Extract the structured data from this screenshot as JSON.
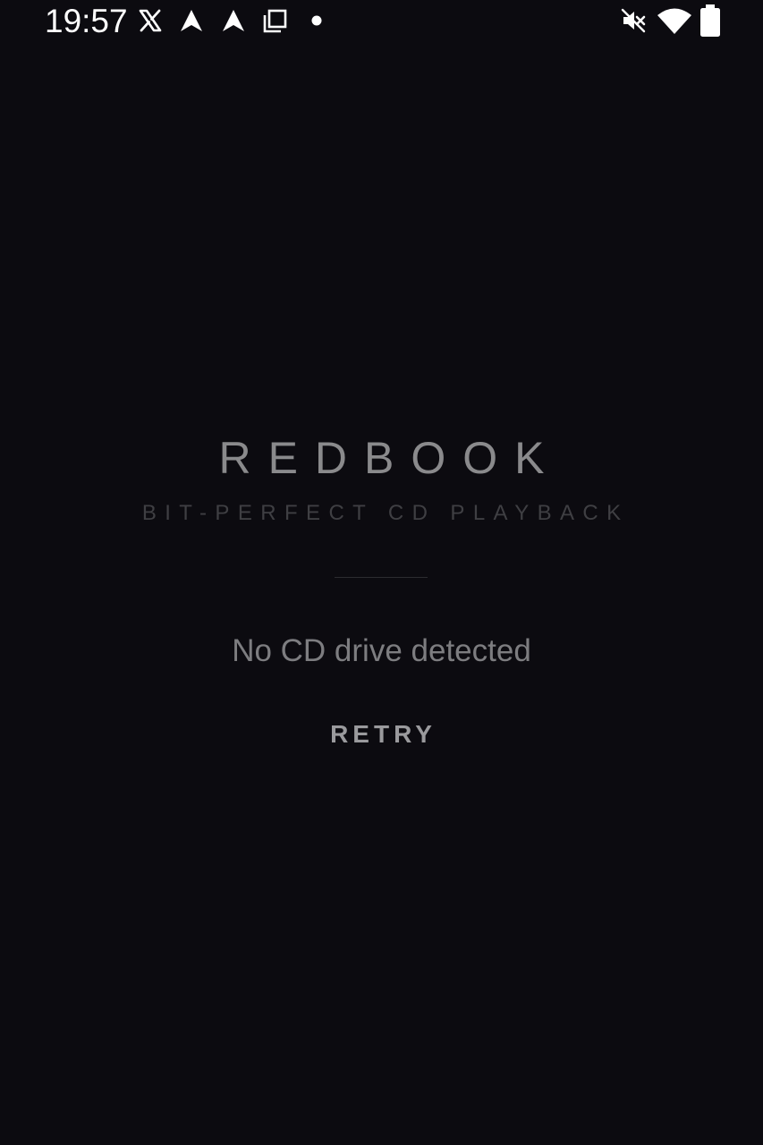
{
  "status_bar": {
    "time": "19:57",
    "notification_icons": [
      "x-logo-icon",
      "send-icon",
      "send-icon",
      "copy-icon",
      "dot-icon"
    ],
    "system_icons": [
      "muted-icon",
      "wifi-icon",
      "battery-icon"
    ]
  },
  "app": {
    "title": "REDBOOK",
    "subtitle": "BIT-PERFECT CD PLAYBACK",
    "message": "No CD drive detected",
    "retry_label": "RETRY"
  },
  "colors": {
    "background": "#0c0b10",
    "title": "#8a8a8c",
    "subtitle": "#3f3f43",
    "message": "#7d7d80",
    "button": "#9a9a9d"
  }
}
